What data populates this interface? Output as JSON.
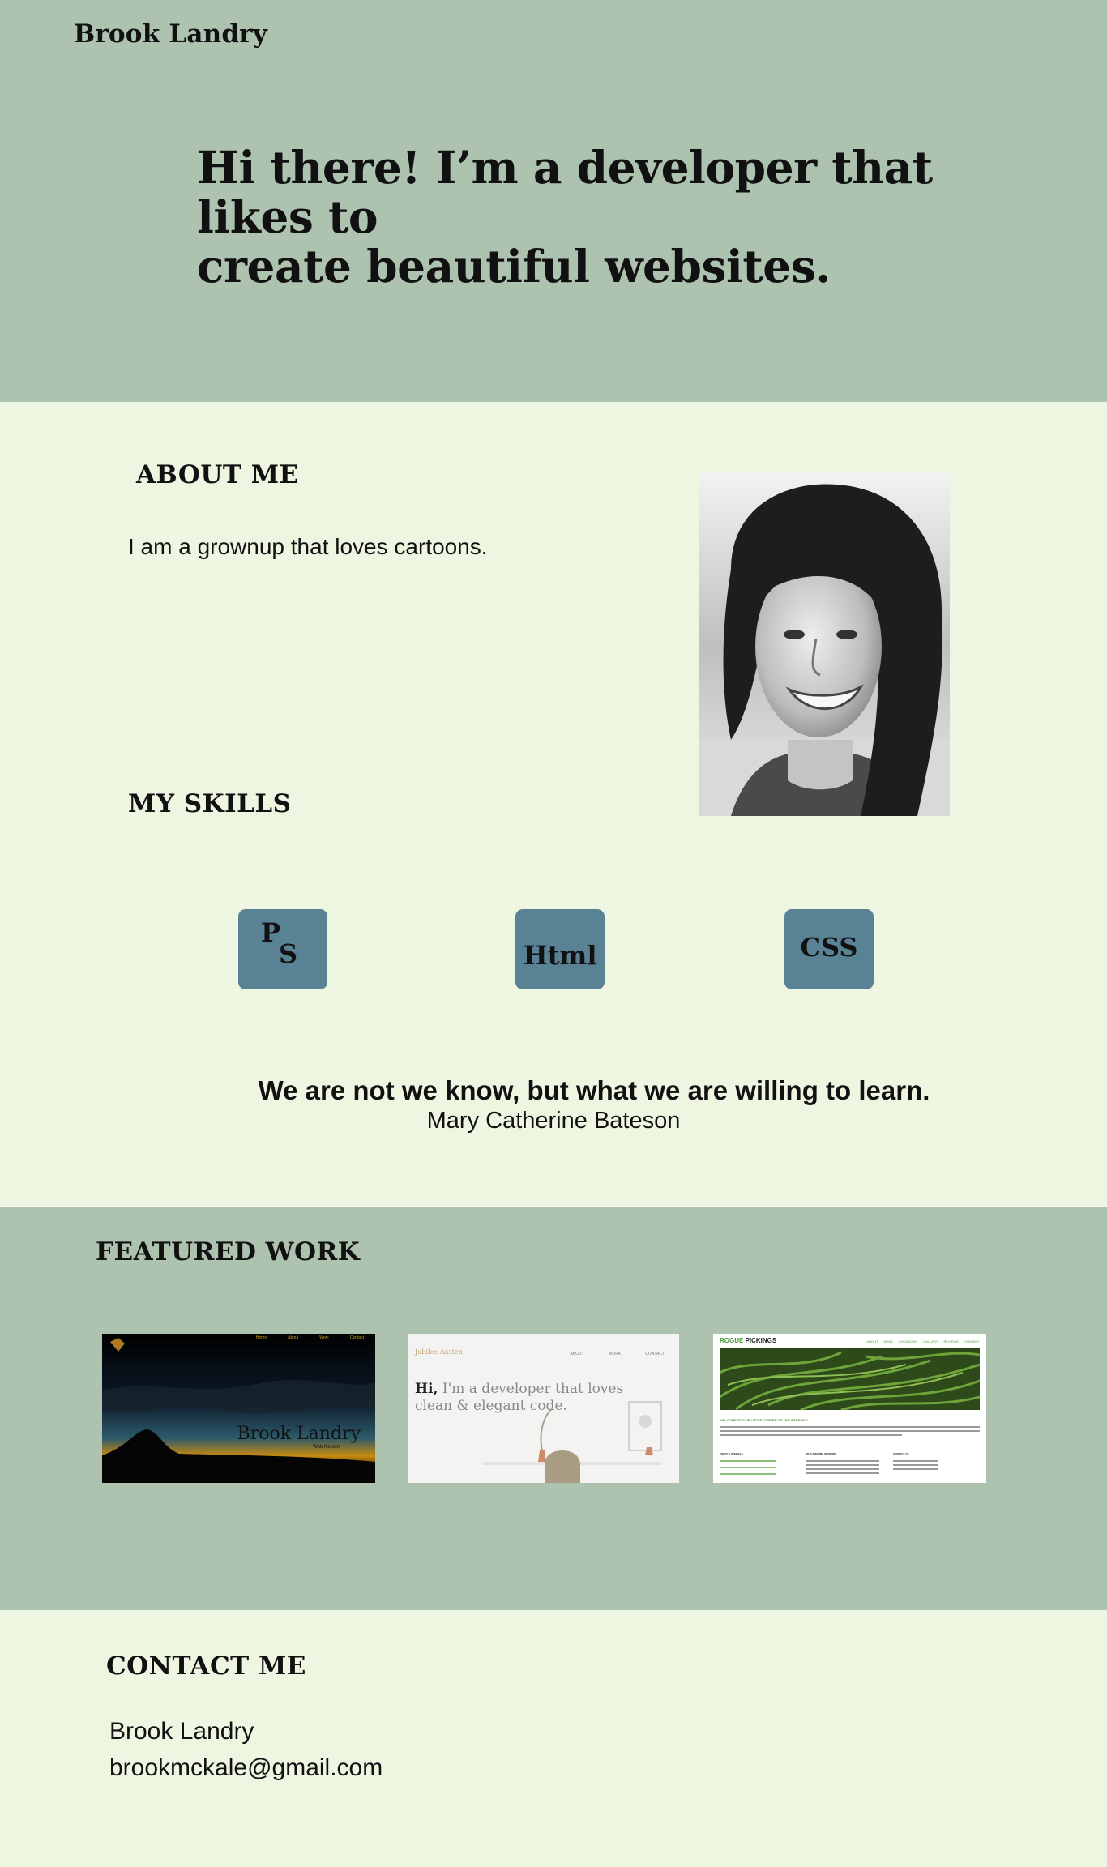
{
  "header": {
    "site_name": "Brook Landry"
  },
  "hero": {
    "title_line1": "Hi there! I’m a developer that likes to",
    "title_line2": "create beautiful websites."
  },
  "about": {
    "heading": "ABOUT ME",
    "text": "I am a grownup that loves cartoons.",
    "portrait_icon": "portrait-photo"
  },
  "skills": {
    "heading": "MY SKILLS",
    "items": [
      {
        "label_p": "P",
        "label_s": "S",
        "name": "photoshop"
      },
      {
        "label": "Html"
      },
      {
        "label": "CSS"
      }
    ]
  },
  "quote": {
    "text": "We are not we know, but what we are willing to learn.",
    "author": "Mary Catherine Bateson"
  },
  "work": {
    "heading": "FEATURED WORK",
    "thumb1": {
      "title": "Brook Landry",
      "subtitle": "Web Person",
      "nav": [
        "Home",
        "About",
        "Work",
        "Contact"
      ]
    },
    "thumb2": {
      "brand": "Jubilee Austen",
      "nav": [
        "ABOUT",
        "WORK",
        "CONTACT"
      ],
      "headline_hi": "Hi,",
      "headline_rest": " I'm a developer that loves",
      "headline_line2": "clean & elegant code."
    },
    "thumb3": {
      "brand_green": "ROGUE",
      "brand_dark": " PICKINGS",
      "nav": [
        "ABOUT",
        "MENU",
        "LOCATIONS",
        "GALLERY",
        "REVIEWS",
        "CONTACT"
      ],
      "welcome": "WELCOME TO OUR LITTLE CORNER OF THE INTERNET!",
      "col1_head": "TODAY'S SPECIALS",
      "col2_head": "OUR AMAZING REVIEWS",
      "col3_head": "CONTACT US"
    }
  },
  "contact": {
    "heading": "CONTACT ME",
    "name": "Brook Landry",
    "email": "brookmckale@gmail.com"
  },
  "colors": {
    "sage": "#adc3af",
    "cream": "#eef5e0",
    "badge": "#5a8295"
  }
}
